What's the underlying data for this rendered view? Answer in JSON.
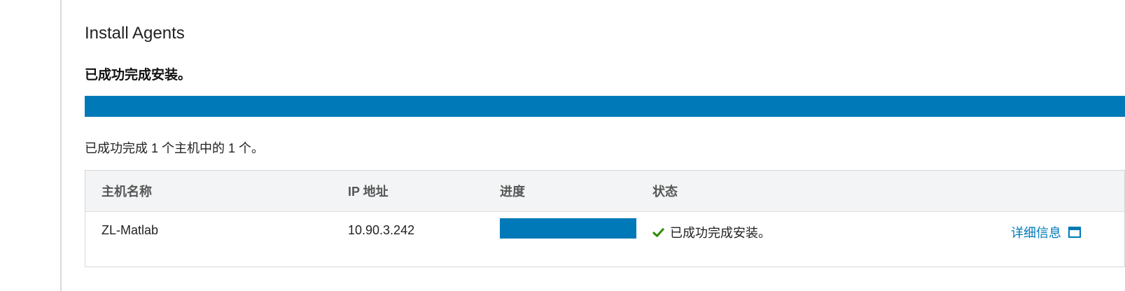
{
  "header": {
    "title": "Install Agents",
    "result": "已成功完成安装。",
    "summary": "已成功完成 1 个主机中的 1 个。"
  },
  "progress": {
    "overall_percent": 100
  },
  "table": {
    "columns": [
      "主机名称",
      "IP 地址",
      "进度",
      "状态"
    ],
    "rows": [
      {
        "host_name": "ZL-Matlab",
        "ip": "10.90.3.242",
        "progress_percent": 100,
        "status": "已成功完成安装。",
        "details_label": "详细信息"
      }
    ]
  },
  "colors": {
    "accent": "#0079b8",
    "success": "#2e8b00",
    "header_bg": "#f3f4f5"
  },
  "icons": {
    "status_icon": "check-icon",
    "details_icon": "window-icon"
  }
}
